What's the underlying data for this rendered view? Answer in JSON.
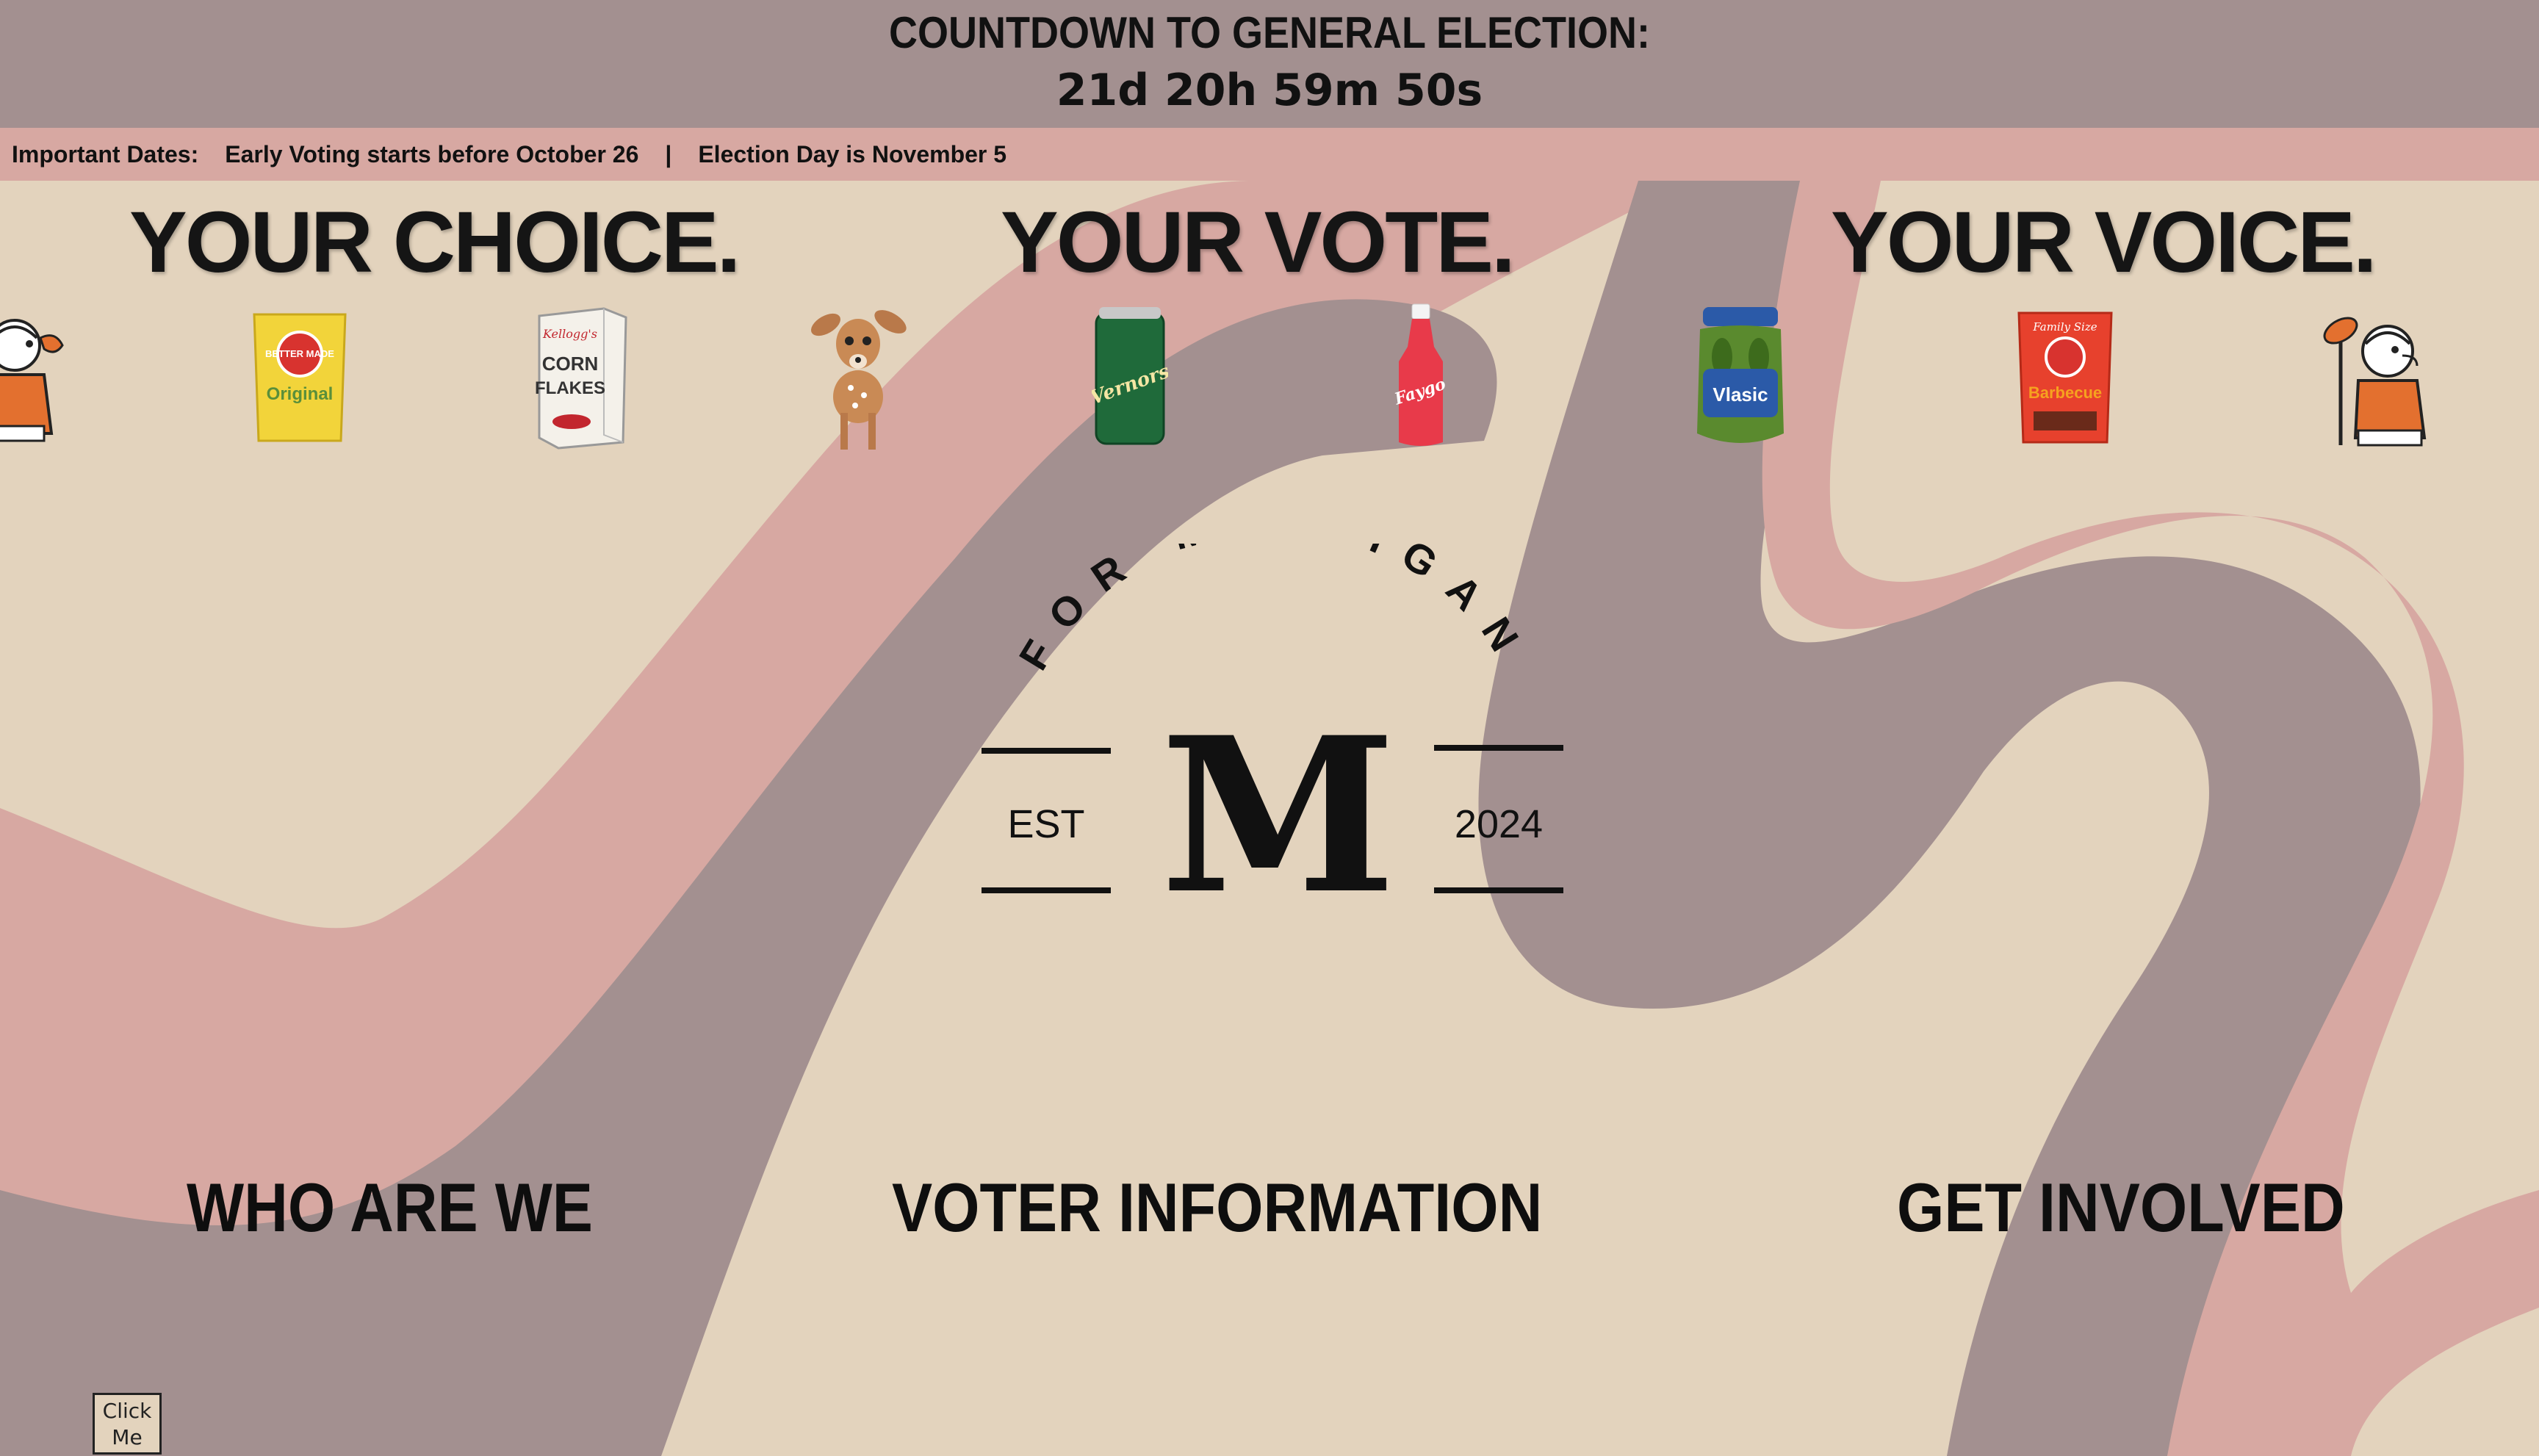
{
  "countdown": {
    "title": "COUNTDOWN TO GENERAL ELECTION:",
    "timer": "21d 20h 59m 50s"
  },
  "important_dates": {
    "label": "Important Dates:",
    "items": [
      "Early Voting starts before October 26",
      "Election Day is November 5"
    ],
    "separator": "|"
  },
  "slogans": [
    "YOUR CHOICE.",
    "YOUR VOTE.",
    "YOUR VOICE."
  ],
  "icons": [
    "little-caesars-mascot-icon",
    "potato-chip-bag-icon",
    "corn-flakes-box-icon",
    "deer-fawn-icon",
    "vernors-can-icon",
    "faygo-bottle-icon",
    "vlasic-pickle-jar-icon",
    "barbecue-chip-bag-icon",
    "little-caesars-mascot-icon"
  ],
  "icon_text": {
    "chips_brand": "BETTER MADE",
    "chips_flavor": "Original",
    "cereal_brand": "Kellogg's",
    "cereal_name_1": "CORN",
    "cereal_name_2": "FLAKES",
    "soda_brand": "Vernors",
    "pop_brand": "Faygo",
    "pickle_brand": "Vlasic",
    "bbq_top": "Family Size",
    "bbq_flavor": "Barbecue"
  },
  "emblem": {
    "arc_text": "FOR MICHIGAN",
    "est": "EST",
    "letter": "M",
    "year": "2024"
  },
  "nav": {
    "who": "WHO ARE WE",
    "voter": "VOTER INFORMATION",
    "involved": "GET INVOLVED"
  },
  "click_button": {
    "line1": "Click",
    "line2": "Me"
  },
  "colors": {
    "background": "#e3d3bd",
    "countdown_bar": "#a39090",
    "dates_bar": "#d7a8a2",
    "wave_pink": "#d7a8a2",
    "wave_mauve": "#a39090"
  }
}
